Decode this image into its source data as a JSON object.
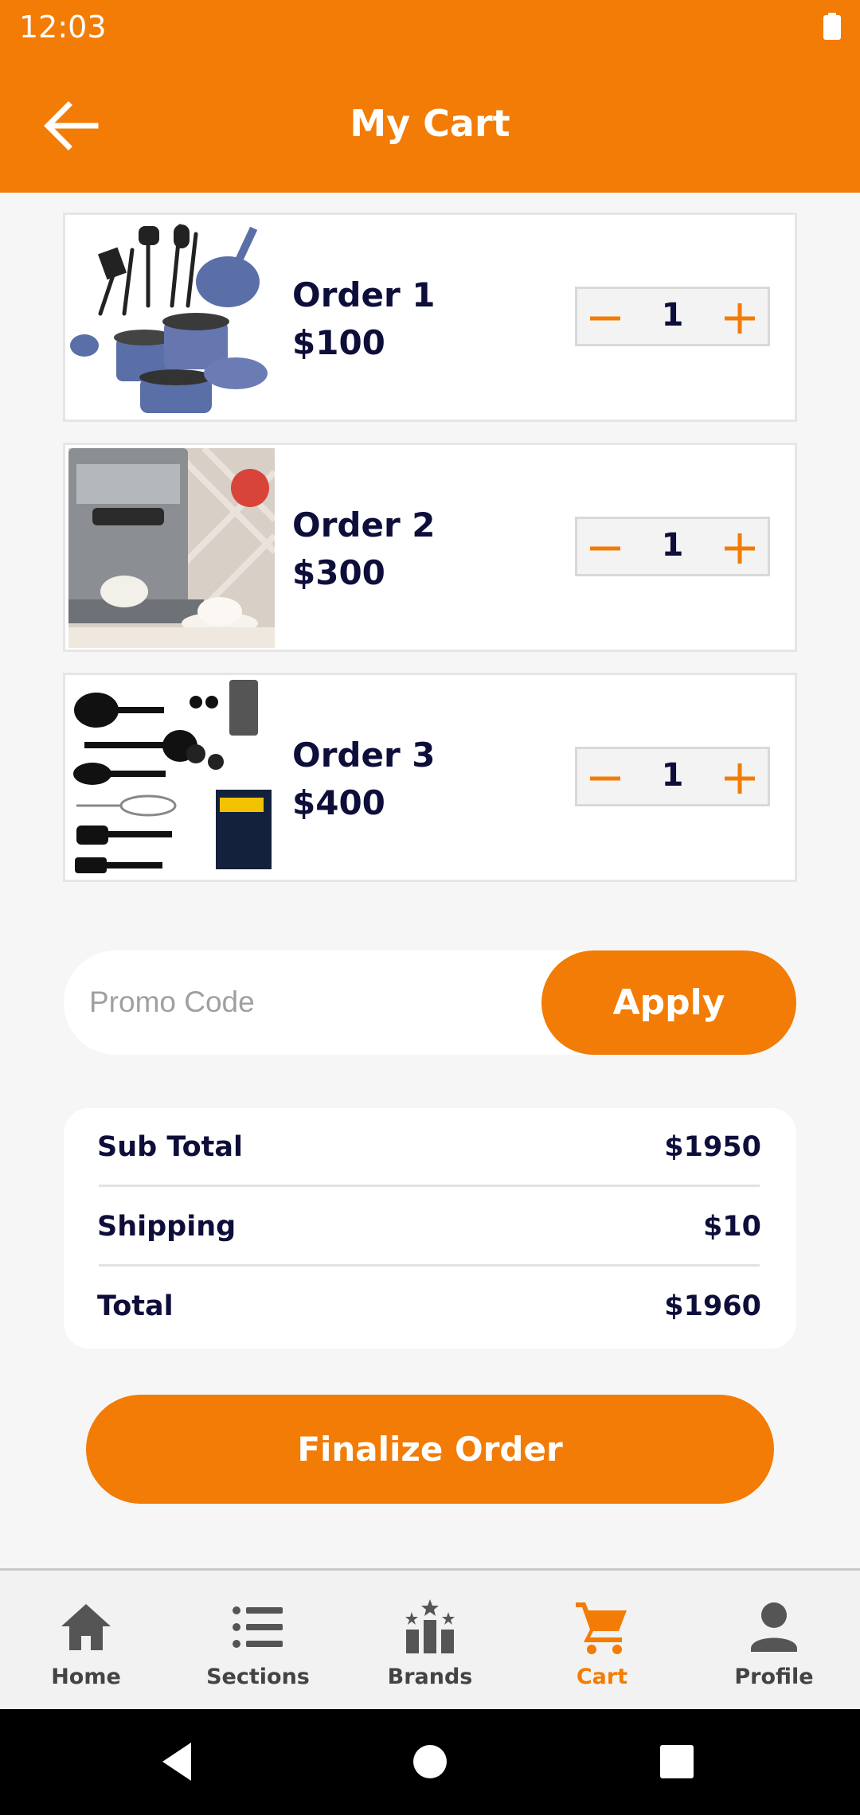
{
  "status_bar": {
    "time": "12:03"
  },
  "header": {
    "title": "My Cart"
  },
  "orders": [
    {
      "name": "Order 1",
      "price": "$100",
      "quantity": "1",
      "image": "cookware-set-image"
    },
    {
      "name": "Order 2",
      "price": "$300",
      "quantity": "1",
      "image": "espresso-machine-image"
    },
    {
      "name": "Order 3",
      "price": "$400",
      "quantity": "1",
      "image": "kitchen-utensils-image"
    }
  ],
  "promo": {
    "placeholder": "Promo Code",
    "value": "",
    "apply_label": "Apply"
  },
  "summary": {
    "subtotal_label": "Sub Total",
    "subtotal_value": "$1950",
    "shipping_label": "Shipping",
    "shipping_value": "$10",
    "total_label": "Total",
    "total_value": "$1960"
  },
  "finalize_label": "Finalize Order",
  "bottom_nav": [
    {
      "label": "Home",
      "icon": "home-icon"
    },
    {
      "label": "Sections",
      "icon": "list-icon"
    },
    {
      "label": "Brands",
      "icon": "brands-icon"
    },
    {
      "label": "Cart",
      "icon": "cart-icon",
      "active": true
    },
    {
      "label": "Profile",
      "icon": "person-icon"
    }
  ],
  "colors": {
    "accent": "#f27c05",
    "text_dark": "#0e0e3b",
    "nav_inactive": "#444444"
  }
}
